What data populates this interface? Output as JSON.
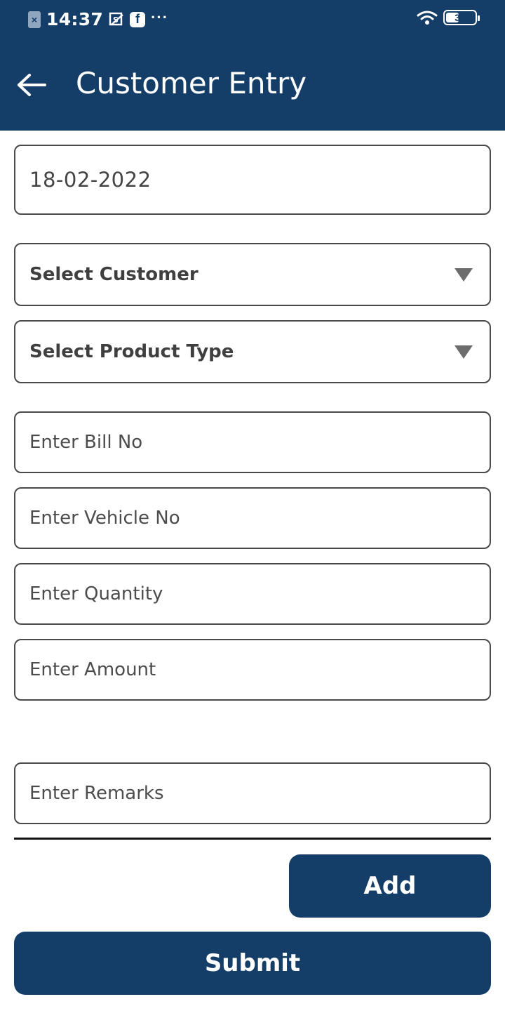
{
  "status_bar": {
    "time": "14:37",
    "battery": "35",
    "icons": [
      "sim-error-icon",
      "screenshot-icon",
      "facebook-icon",
      "more-icon",
      "wifi-icon",
      "battery-icon"
    ]
  },
  "header": {
    "title": "Customer Entry",
    "back_icon": "arrow-left-icon"
  },
  "form": {
    "date": "18-02-2022",
    "customer_select": "Select Customer",
    "product_type_select": "Select Product Type",
    "bill_no_placeholder": "Enter Bill No",
    "vehicle_no_placeholder": "Enter Vehicle No",
    "quantity_placeholder": "Enter Quantity",
    "amount_placeholder": "Enter Amount",
    "remarks_placeholder": "Enter Remarks"
  },
  "actions": {
    "add_label": "Add",
    "submit_label": "Submit"
  },
  "colors": {
    "primary": "#143d68",
    "border": "#4a4a4a"
  }
}
